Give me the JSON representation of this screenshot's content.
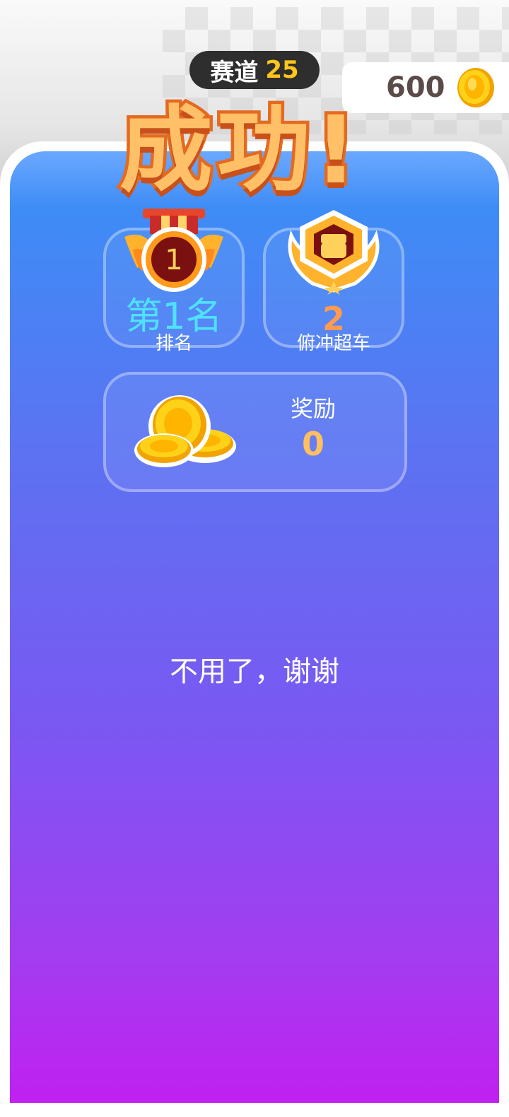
{
  "header": {
    "track_label": "赛道",
    "track_number": "25",
    "coins": "600"
  },
  "result": {
    "title": "成功!"
  },
  "stats": {
    "rank_text": "第1名",
    "rank_label": "排名",
    "overtake_value": "2",
    "overtake_label": "俯冲超车"
  },
  "reward": {
    "label": "奖励",
    "value": "0"
  },
  "actions": {
    "no_thanks": "不用了，谢谢"
  },
  "colors": {
    "accent_gold": "#ffc61a",
    "title_fill": "#ffc067",
    "title_stroke": "#e46a20",
    "rank_cyan": "#4fe1ff",
    "panel_top": "#3e8cf6",
    "panel_bottom": "#c020f0"
  },
  "icons": {
    "coin": "coin-icon",
    "medal": "medal-rank-1-icon",
    "fist_badge": "fist-badge-icon",
    "coin_pile": "coin-pile-icon"
  }
}
